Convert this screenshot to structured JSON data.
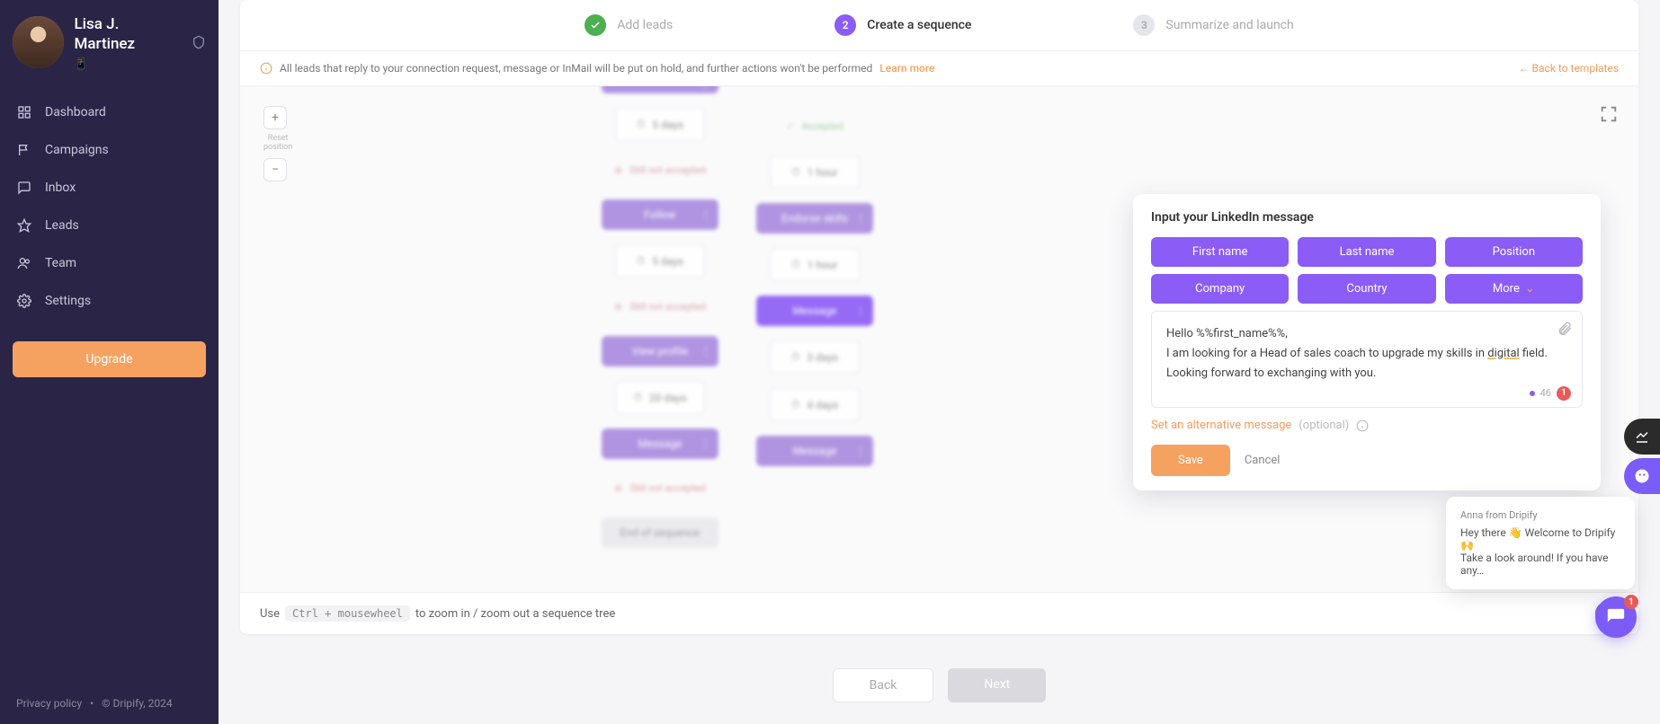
{
  "profile": {
    "name": "Lisa J. Martinez",
    "sub": "📱"
  },
  "nav": {
    "items": [
      {
        "label": "Dashboard",
        "icon": "grid"
      },
      {
        "label": "Campaigns",
        "icon": "flag"
      },
      {
        "label": "Inbox",
        "icon": "message"
      },
      {
        "label": "Leads",
        "icon": "star"
      },
      {
        "label": "Team",
        "icon": "users"
      },
      {
        "label": "Settings",
        "icon": "gear"
      }
    ],
    "upgrade": "Upgrade"
  },
  "footer": {
    "privacy": "Privacy policy",
    "copyright": "© Dripify, 2024"
  },
  "stepper": {
    "steps": [
      {
        "num": "✓",
        "label": "Add leads",
        "state": "done"
      },
      {
        "num": "2",
        "label": "Create a sequence",
        "state": "active"
      },
      {
        "num": "3",
        "label": "Summarize and launch",
        "state": "pending"
      }
    ]
  },
  "notice": {
    "text": "All leads that reply to your connection request, message or InMail will be put on hold, and further actions won't be performed",
    "learn": "Learn more",
    "back": "← Back to templates"
  },
  "zoom": {
    "plus": "+",
    "reset_line1": "Reset",
    "reset_line2": "position",
    "minus": "−"
  },
  "sequence": {
    "left": [
      {
        "type": "node",
        "label": ""
      },
      {
        "type": "delay",
        "label": "5 days"
      },
      {
        "type": "cond",
        "label": "Still not accepted"
      },
      {
        "type": "node",
        "label": "Follow"
      },
      {
        "type": "delay",
        "label": "5 days"
      },
      {
        "type": "cond",
        "label": "Still not accepted"
      },
      {
        "type": "node",
        "label": "View profile"
      },
      {
        "type": "delay",
        "label": "20 days"
      },
      {
        "type": "node",
        "label": "Message"
      },
      {
        "type": "cond",
        "label": "Still not accepted"
      },
      {
        "type": "end",
        "label": "End of sequence"
      },
      {
        "type": "sub",
        "label": ""
      }
    ],
    "right": [
      {
        "type": "cond",
        "label": "Accepted",
        "green": true
      },
      {
        "type": "delay",
        "label": "1 hour"
      },
      {
        "type": "node",
        "label": "Endorse skills"
      },
      {
        "type": "delay",
        "label": "1 hour"
      },
      {
        "type": "node",
        "label": "Message",
        "strong": true
      },
      {
        "type": "delay",
        "label": "3 days"
      },
      {
        "type": "delay",
        "label": "4 days"
      },
      {
        "type": "node",
        "label": "Message"
      }
    ]
  },
  "popover": {
    "title": "Input your LinkedIn message",
    "tokens_row1": [
      "First name",
      "Last name",
      "Position"
    ],
    "tokens_row2": [
      "Company",
      "Country",
      "More"
    ],
    "body_line1": "Hello %%first_name%%,",
    "body_line2_a": "I am looking for a Head of sales coach to upgrade my skills in ",
    "body_line2_u": "digital",
    "body_line2_b": " field.",
    "body_line3": "Looking forward to exchanging with you.",
    "count": "46",
    "count_badge": "1",
    "alt_link": "Set an alternative message",
    "alt_opt": "(optional)",
    "save": "Save",
    "cancel": "Cancel"
  },
  "hint": {
    "pre": "Use",
    "kbd": "Ctrl + mousewheel",
    "post": "to zoom in / zoom out a sequence tree"
  },
  "navbtn": {
    "back": "Back",
    "next": "Next"
  },
  "chat": {
    "from": "Anna from Dripify",
    "line1": "Hey there 👋 Welcome to Dripify 🙌",
    "line2": "Take a look around! If you have any…",
    "badge": "1"
  }
}
